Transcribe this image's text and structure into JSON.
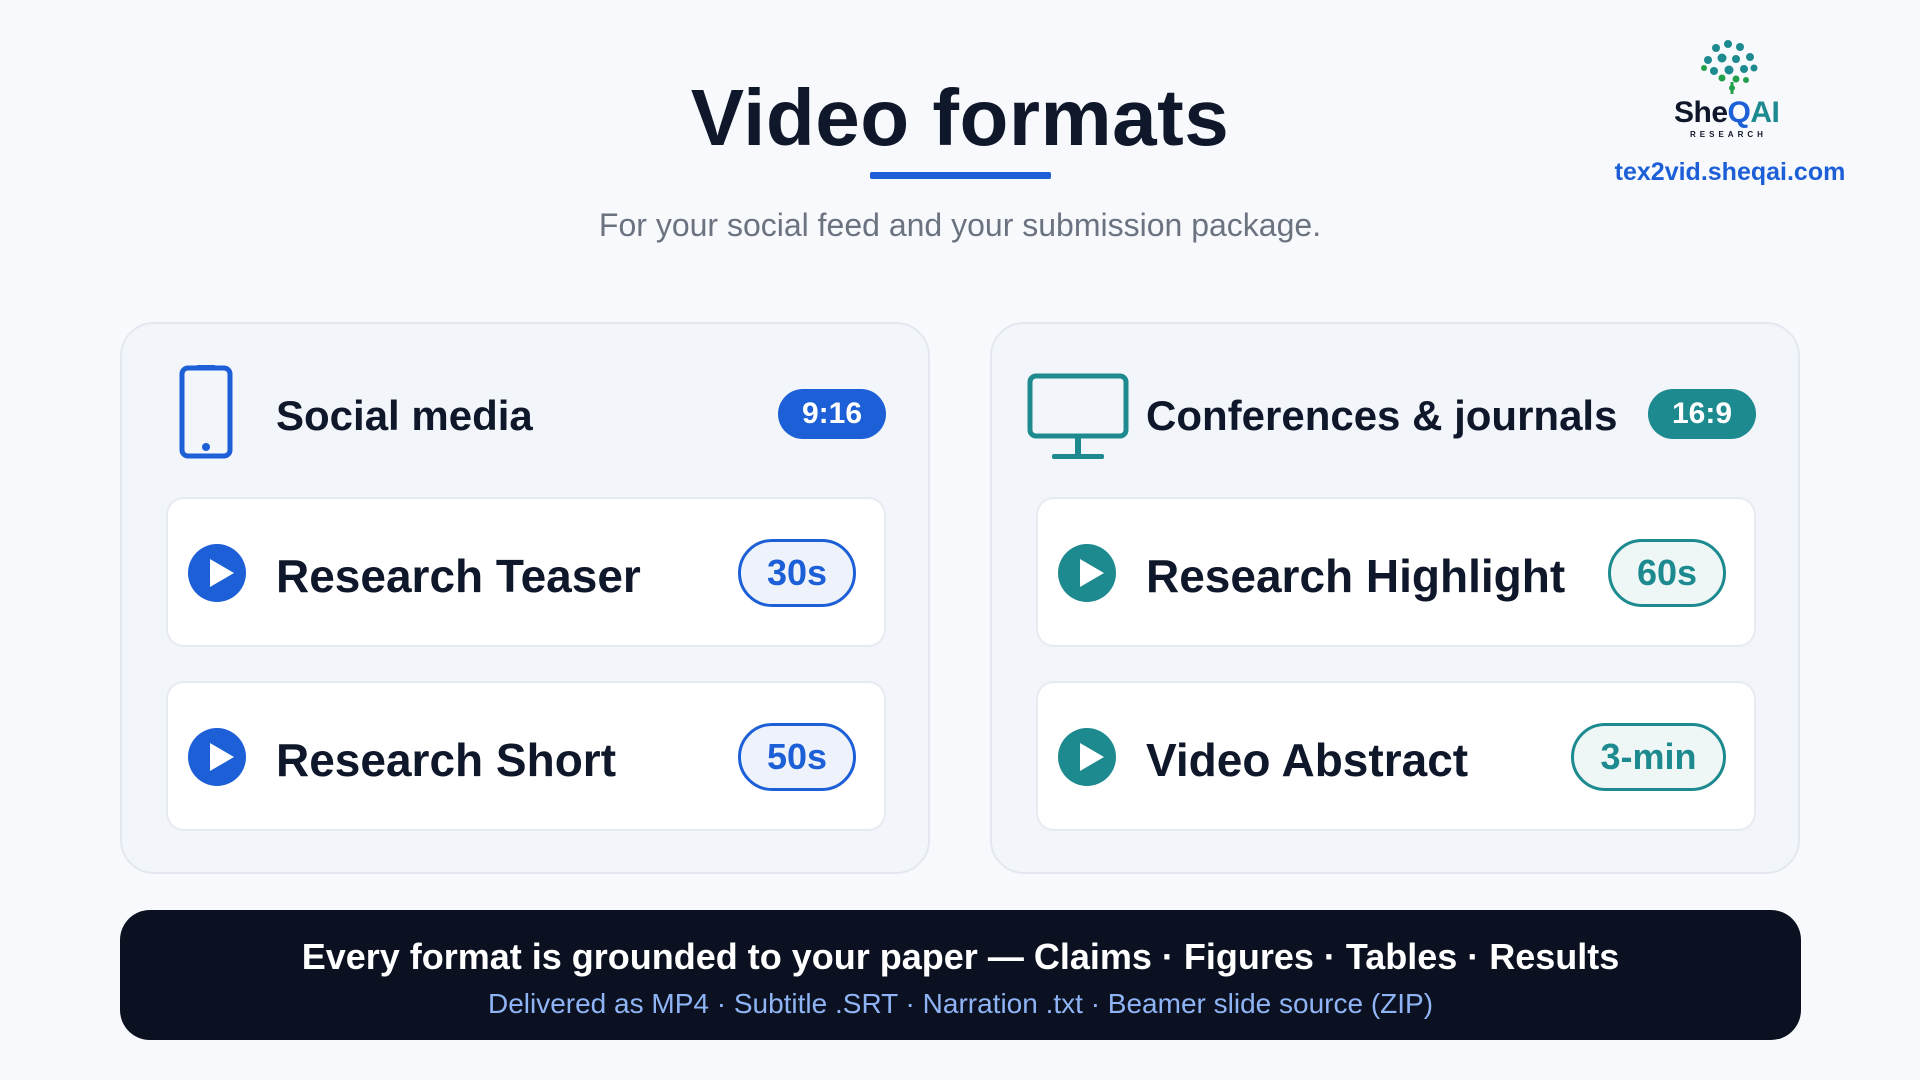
{
  "header": {
    "title": "Video formats",
    "subtitle": "For your social feed and your submission package."
  },
  "logo": {
    "word_she": "She",
    "word_q": "Q",
    "word_ai": "AI",
    "sub": "RESEARCH",
    "link": "tex2vid.sheqai.com"
  },
  "panels": [
    {
      "title": "Social media",
      "ratio": "9:16",
      "icon": "phone-icon",
      "accent": "#1d5fd6",
      "items": [
        {
          "label": "Research Teaser",
          "duration": "30s"
        },
        {
          "label": "Research Short",
          "duration": "50s"
        }
      ]
    },
    {
      "title": "Conferences & journals",
      "ratio": "16:9",
      "icon": "monitor-icon",
      "accent": "#1d8a8f",
      "items": [
        {
          "label": "Research Highlight",
          "duration": "60s"
        },
        {
          "label": "Video Abstract",
          "duration": "3-min"
        }
      ]
    }
  ],
  "footer": {
    "main": "Every format is grounded to your paper — Claims · Figures · Tables · Results",
    "sub": "Delivered as MP4 · Subtitle .SRT · Narration .txt · Beamer slide source (ZIP)"
  }
}
